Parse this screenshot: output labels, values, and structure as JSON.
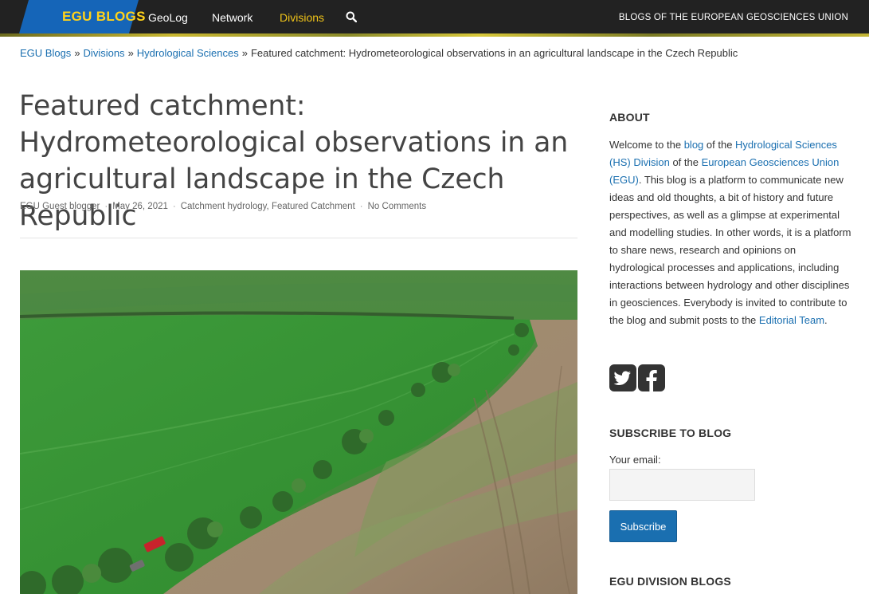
{
  "header": {
    "logo_text": "EGU BLOGS",
    "nav": [
      {
        "label": "GeoLog",
        "active": false
      },
      {
        "label": "Network",
        "active": false
      },
      {
        "label": "Divisions",
        "active": true
      }
    ],
    "tagline": "BLOGS OF THE EUROPEAN GEOSCIENCES UNION",
    "search_icon": "search-icon"
  },
  "breadcrumb": {
    "items": [
      "EGU Blogs",
      "Divisions",
      "Hydrological Sciences"
    ],
    "separator": "»",
    "current": "Featured catchment: Hydrometeorological observations in an agricultural landscape in the Czech Republic"
  },
  "post": {
    "title": "Featured catchment: Hydrometeorological observations in an agricultural landscape in the Czech Republic",
    "author": "EGU Guest blogger",
    "date": "May 26, 2021",
    "category_1": "Catchment hydrology",
    "category_2": "Featured Catchment",
    "comments": "No Comments"
  },
  "sidebar": {
    "about_heading": "ABOUT",
    "about": {
      "t1": "Welcome to the ",
      "l1": "blog",
      "t2": " of the ",
      "l2": "Hydrological Sciences (HS) Division",
      "t3": " of the ",
      "l3": "European Geosciences Union (EGU)",
      "t4": ". This blog is a platform to communicate new ideas and old thoughts, a bit of history and future perspectives, as well as a glimpse at experimental and modelling studies. In other words, it is a platform to share news, research and opinions on hydrological processes and applications, including interactions between hydrology and other disciplines in geosciences. Everybody is invited to contribute to the blog and submit posts to the ",
      "l4": "Editorial Team",
      "t5": "."
    },
    "social_icons": [
      "twitter-icon",
      "facebook-icon"
    ],
    "subscribe_heading": "SUBSCRIBE TO BLOG",
    "email_label": "Your email:",
    "email_value": "",
    "subscribe_label": "Subscribe",
    "division_heading": "EGU DIVISION BLOGS"
  },
  "colors": {
    "topbar": "#222222",
    "accent_yellow": "#f0c419",
    "link": "#1a6fb0"
  }
}
